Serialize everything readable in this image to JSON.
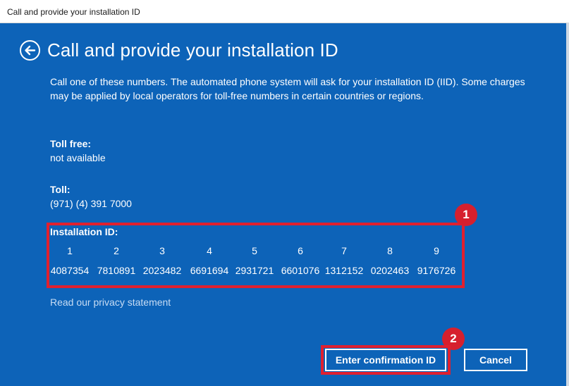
{
  "window": {
    "title": "Call and provide your installation ID"
  },
  "page": {
    "heading": "Call and provide your installation ID",
    "description": "Call one of these numbers. The automated phone system will ask for your installation ID (IID). Some charges may be applied by local operators for toll-free numbers in certain countries or regions."
  },
  "toll_free": {
    "label": "Toll free:",
    "value": "not available"
  },
  "toll": {
    "label": "Toll:",
    "value": "(971) (4) 391 7000"
  },
  "installation_id": {
    "label": "Installation ID:",
    "columns": [
      "1",
      "2",
      "3",
      "4",
      "5",
      "6",
      "7",
      "8",
      "9"
    ],
    "groups": [
      "4087354",
      "7810891",
      "2023482",
      "6691694",
      "2931721",
      "6601076",
      "1312152",
      "0202463",
      "9176726"
    ]
  },
  "privacy_link": "Read our privacy statement",
  "annotations": {
    "badge_1": "1",
    "badge_2": "2"
  },
  "buttons": {
    "enter_confirmation": "Enter confirmation ID",
    "cancel": "Cancel"
  },
  "colors": {
    "background": "#0d63b8",
    "highlight": "#e0202f",
    "text": "#ffffff"
  }
}
